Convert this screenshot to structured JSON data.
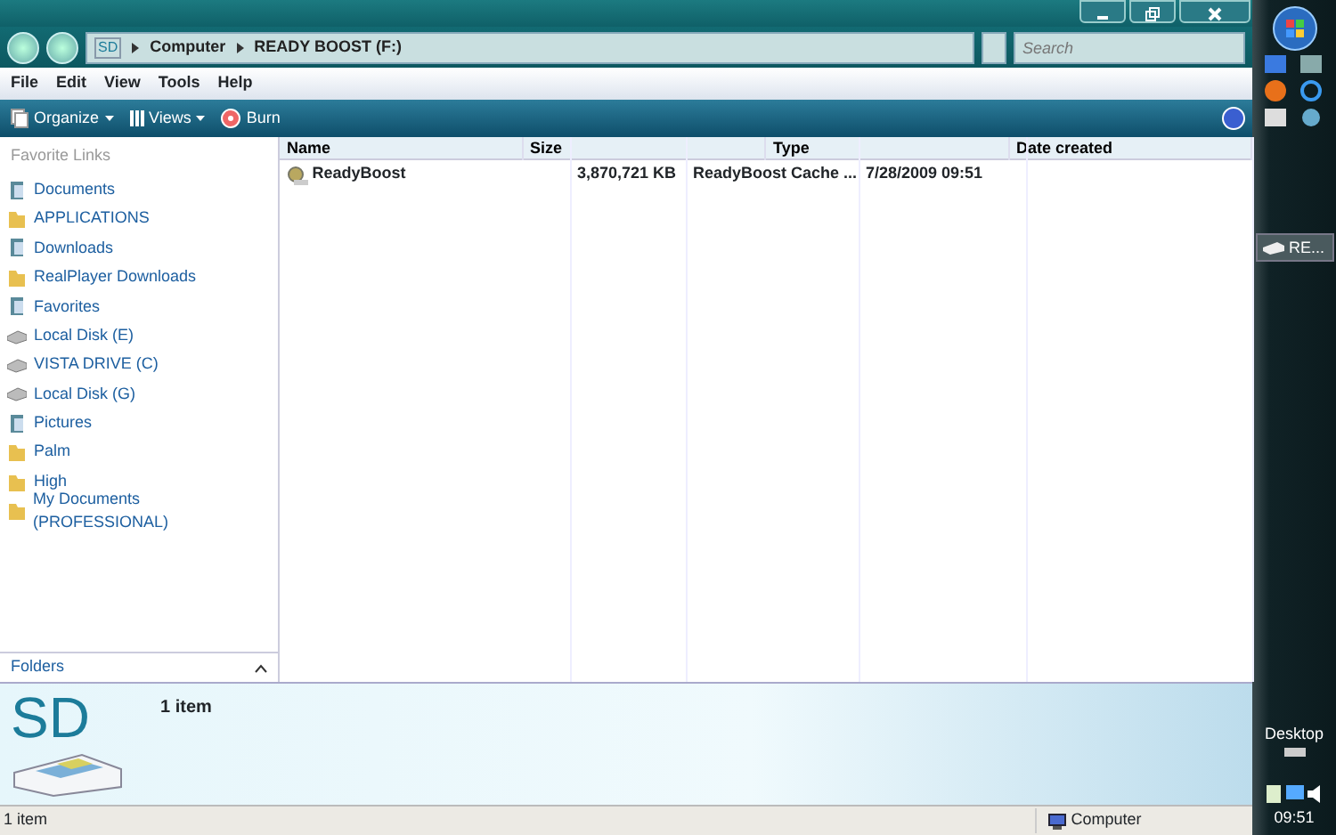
{
  "address": {
    "drive_label": "SD",
    "crumbs": [
      "Computer",
      "READY BOOST (F:)"
    ]
  },
  "search": {
    "placeholder": "Search"
  },
  "menu": [
    "File",
    "Edit",
    "View",
    "Tools",
    "Help"
  ],
  "toolbar": [
    {
      "label": "Organize",
      "kind": "organize"
    },
    {
      "label": "Views",
      "kind": "views"
    },
    {
      "label": "Burn",
      "kind": "burn"
    }
  ],
  "sidebar": {
    "title": "Favorite Links",
    "items": [
      {
        "label": "Documents",
        "kind": "library"
      },
      {
        "label": "APPLICATIONS",
        "kind": "folder"
      },
      {
        "label": "Downloads",
        "kind": "library"
      },
      {
        "label": "RealPlayer Downloads",
        "kind": "folder"
      },
      {
        "label": "Favorites",
        "kind": "library"
      },
      {
        "label": "Local Disk (E)",
        "kind": "drive"
      },
      {
        "label": "VISTA DRIVE (C)",
        "kind": "drive"
      },
      {
        "label": "Local Disk (G)",
        "kind": "drive"
      },
      {
        "label": "Pictures",
        "kind": "library"
      },
      {
        "label": "Palm",
        "kind": "folder"
      },
      {
        "label": "High",
        "kind": "folder"
      },
      {
        "label": "My Documents (PROFESSIONAL)",
        "kind": "folder"
      }
    ],
    "folders_label": "Folders"
  },
  "table": {
    "columns": [
      "Name",
      "Size",
      "Type",
      "Date created"
    ],
    "rows": [
      {
        "cells": [
          "ReadyBoost",
          "3,870,721 KB",
          "ReadyBoost Cache ...",
          "7/28/2009 09:51"
        ]
      }
    ]
  },
  "details": {
    "logo": "SD",
    "summary": "1 item"
  },
  "status_bar": {
    "text": "1 item",
    "zone": "Computer"
  },
  "taskbar": {
    "window": "RE...",
    "desktop": "Desktop",
    "clock": "09:51"
  }
}
